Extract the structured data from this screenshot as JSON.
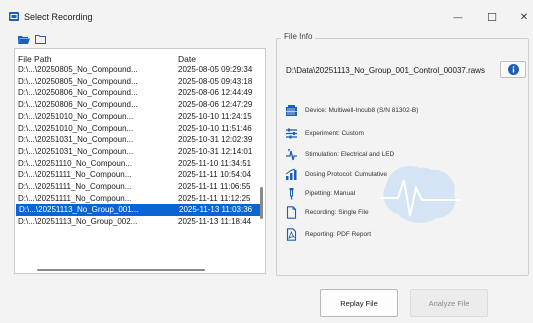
{
  "window": {
    "title": "Select Recording",
    "minimize_glyph": "—",
    "maximize_glyph": "☐",
    "close_glyph": "✕"
  },
  "toolbar": {
    "icons": [
      "folder-open-icon",
      "folder-icon"
    ]
  },
  "list": {
    "columns": {
      "path": "File Path",
      "date": "Date"
    },
    "rows": [
      {
        "path": "D:\\...\\20250805_No_Compound...",
        "date": "2025-08-05 09:29:34"
      },
      {
        "path": "D:\\...\\20250805_No_Compound...",
        "date": "2025-08-05 09:43:18"
      },
      {
        "path": "D:\\...\\20250806_No_Compound...",
        "date": "2025-08-06 12:44:49"
      },
      {
        "path": "D:\\...\\20250806_No_Compound...",
        "date": "2025-08-06 12:47:29"
      },
      {
        "path": "D:\\...\\20251010_No_Compoun...",
        "date": "2025-10-10 11:24:15"
      },
      {
        "path": "D:\\...\\20251010_No_Compoun...",
        "date": "2025-10-10 11:51:46"
      },
      {
        "path": "D:\\...\\20251031_No_Compoun...",
        "date": "2025-10-31 12:02:39"
      },
      {
        "path": "D:\\...\\20251031_No_Compoun...",
        "date": "2025-10-31 12:14:01"
      },
      {
        "path": "D:\\...\\20251110_No_Compoun...",
        "date": "2025-11-10 11:34:51"
      },
      {
        "path": "D:\\...\\20251111_No_Compoun...",
        "date": "2025-11-11 10:54:04"
      },
      {
        "path": "D:\\...\\20251111_No_Compoun...",
        "date": "2025-11-11 11:06:55"
      },
      {
        "path": "D:\\...\\20251111_No_Compoun...",
        "date": "2025-11-11 11:12:25"
      },
      {
        "path": "D:\\...\\20251113_No_Group_001...",
        "date": "2025-11-13 11:03:36",
        "selected": true
      },
      {
        "path": "D:\\...\\20251113_No_Group_002...",
        "date": "2025-11-13 11:18:44"
      }
    ]
  },
  "file_info": {
    "legend": "File Info",
    "path": "D:\\Data\\20251113_No_Group_001_Control_00037.raws",
    "details": [
      {
        "icon": "device-icon",
        "label": "Device: Multiwell-Incub8 (S/N 81302-B)"
      },
      {
        "icon": "sliders-icon",
        "label": "Experiment: Custom"
      },
      {
        "icon": "stimulation-icon",
        "label": "Stimulation: Electrical and LED"
      },
      {
        "icon": "dosing-icon",
        "label": "Dosing Protocol: Cumulative"
      },
      {
        "icon": "pipette-icon",
        "label": "Pipetting: Manual"
      },
      {
        "icon": "file-icon",
        "label": "Recording: Single File"
      },
      {
        "icon": "pdf-icon",
        "label": "Reporting: PDF Report"
      }
    ]
  },
  "buttons": {
    "replay": "Replay File",
    "analyze": "Analyze File"
  },
  "colors": {
    "accent": "#0a64d2",
    "icon_blue": "#1e5fb3",
    "watermark": "#cfe0f2"
  }
}
